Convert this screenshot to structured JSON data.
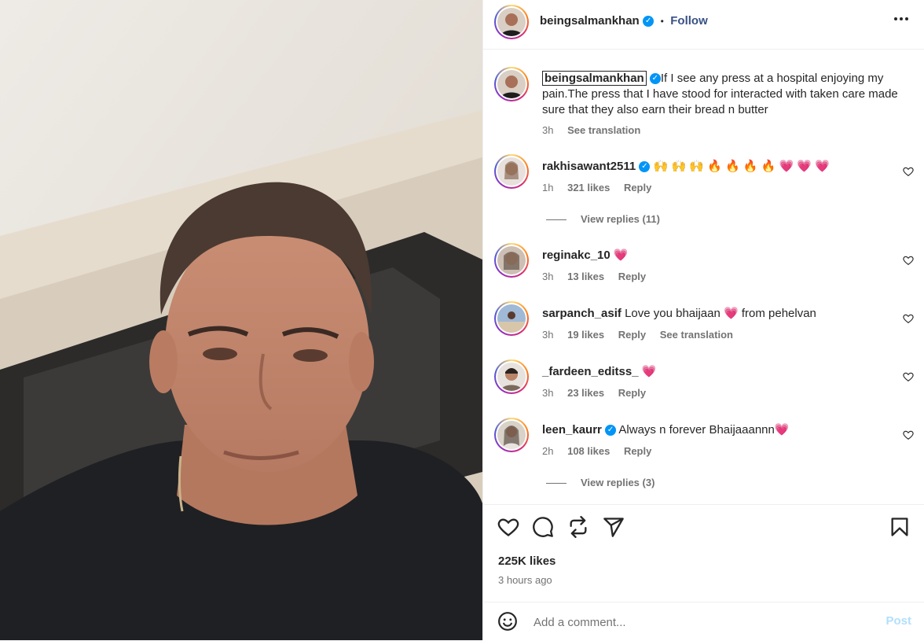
{
  "post": {
    "author": "beingsalmankhan",
    "follow_label": "Follow",
    "separator": "•",
    "caption": "If I see any press at a hospital enjoying my pain.The press that I have stood for interacted with taken care made sure that they also earn their bread n butter",
    "caption_time": "3h",
    "see_translation": "See translation",
    "likes": "225K likes",
    "time_ago": "3 hours ago"
  },
  "comments": [
    {
      "user": "rakhisawant2511",
      "verified": true,
      "text": "🙌 🙌 🙌 🔥 🔥 🔥 🔥 💗 💗 💗",
      "time": "1h",
      "likes": "321 likes",
      "reply": "Reply",
      "view_replies": "View replies (11)"
    },
    {
      "user": "reginakc_10",
      "verified": false,
      "text": "💗",
      "time": "3h",
      "likes": "13 likes",
      "reply": "Reply"
    },
    {
      "user": "sarpanch_asif",
      "verified": false,
      "text": "Love you bhaijaan 💗  from pehelvan",
      "time": "3h",
      "likes": "19 likes",
      "reply": "Reply",
      "see_translation": "See translation"
    },
    {
      "user": "_fardeen_editss_",
      "verified": false,
      "text": "💗",
      "time": "3h",
      "likes": "23 likes",
      "reply": "Reply"
    },
    {
      "user": "leen_kaurr",
      "verified": true,
      "text": "Always n forever Bhaijaaannn💗",
      "time": "2h",
      "likes": "108 likes",
      "reply": "Reply",
      "view_replies": "View replies (3)"
    }
  ],
  "composer": {
    "placeholder": "Add a comment...",
    "post_label": "Post"
  },
  "icons": {
    "header_more": "more-options-icon",
    "verified": "verified-badge-icon",
    "like": "heart-icon",
    "comment": "comment-bubble-icon",
    "repost": "repost-icon",
    "share": "share-plane-icon",
    "save": "bookmark-icon",
    "emoji": "emoji-icon"
  },
  "colors": {
    "accent_blue": "#0095f6",
    "follow_blue": "#385185",
    "post_disabled": "#b2dffc",
    "muted_text": "#737373"
  }
}
